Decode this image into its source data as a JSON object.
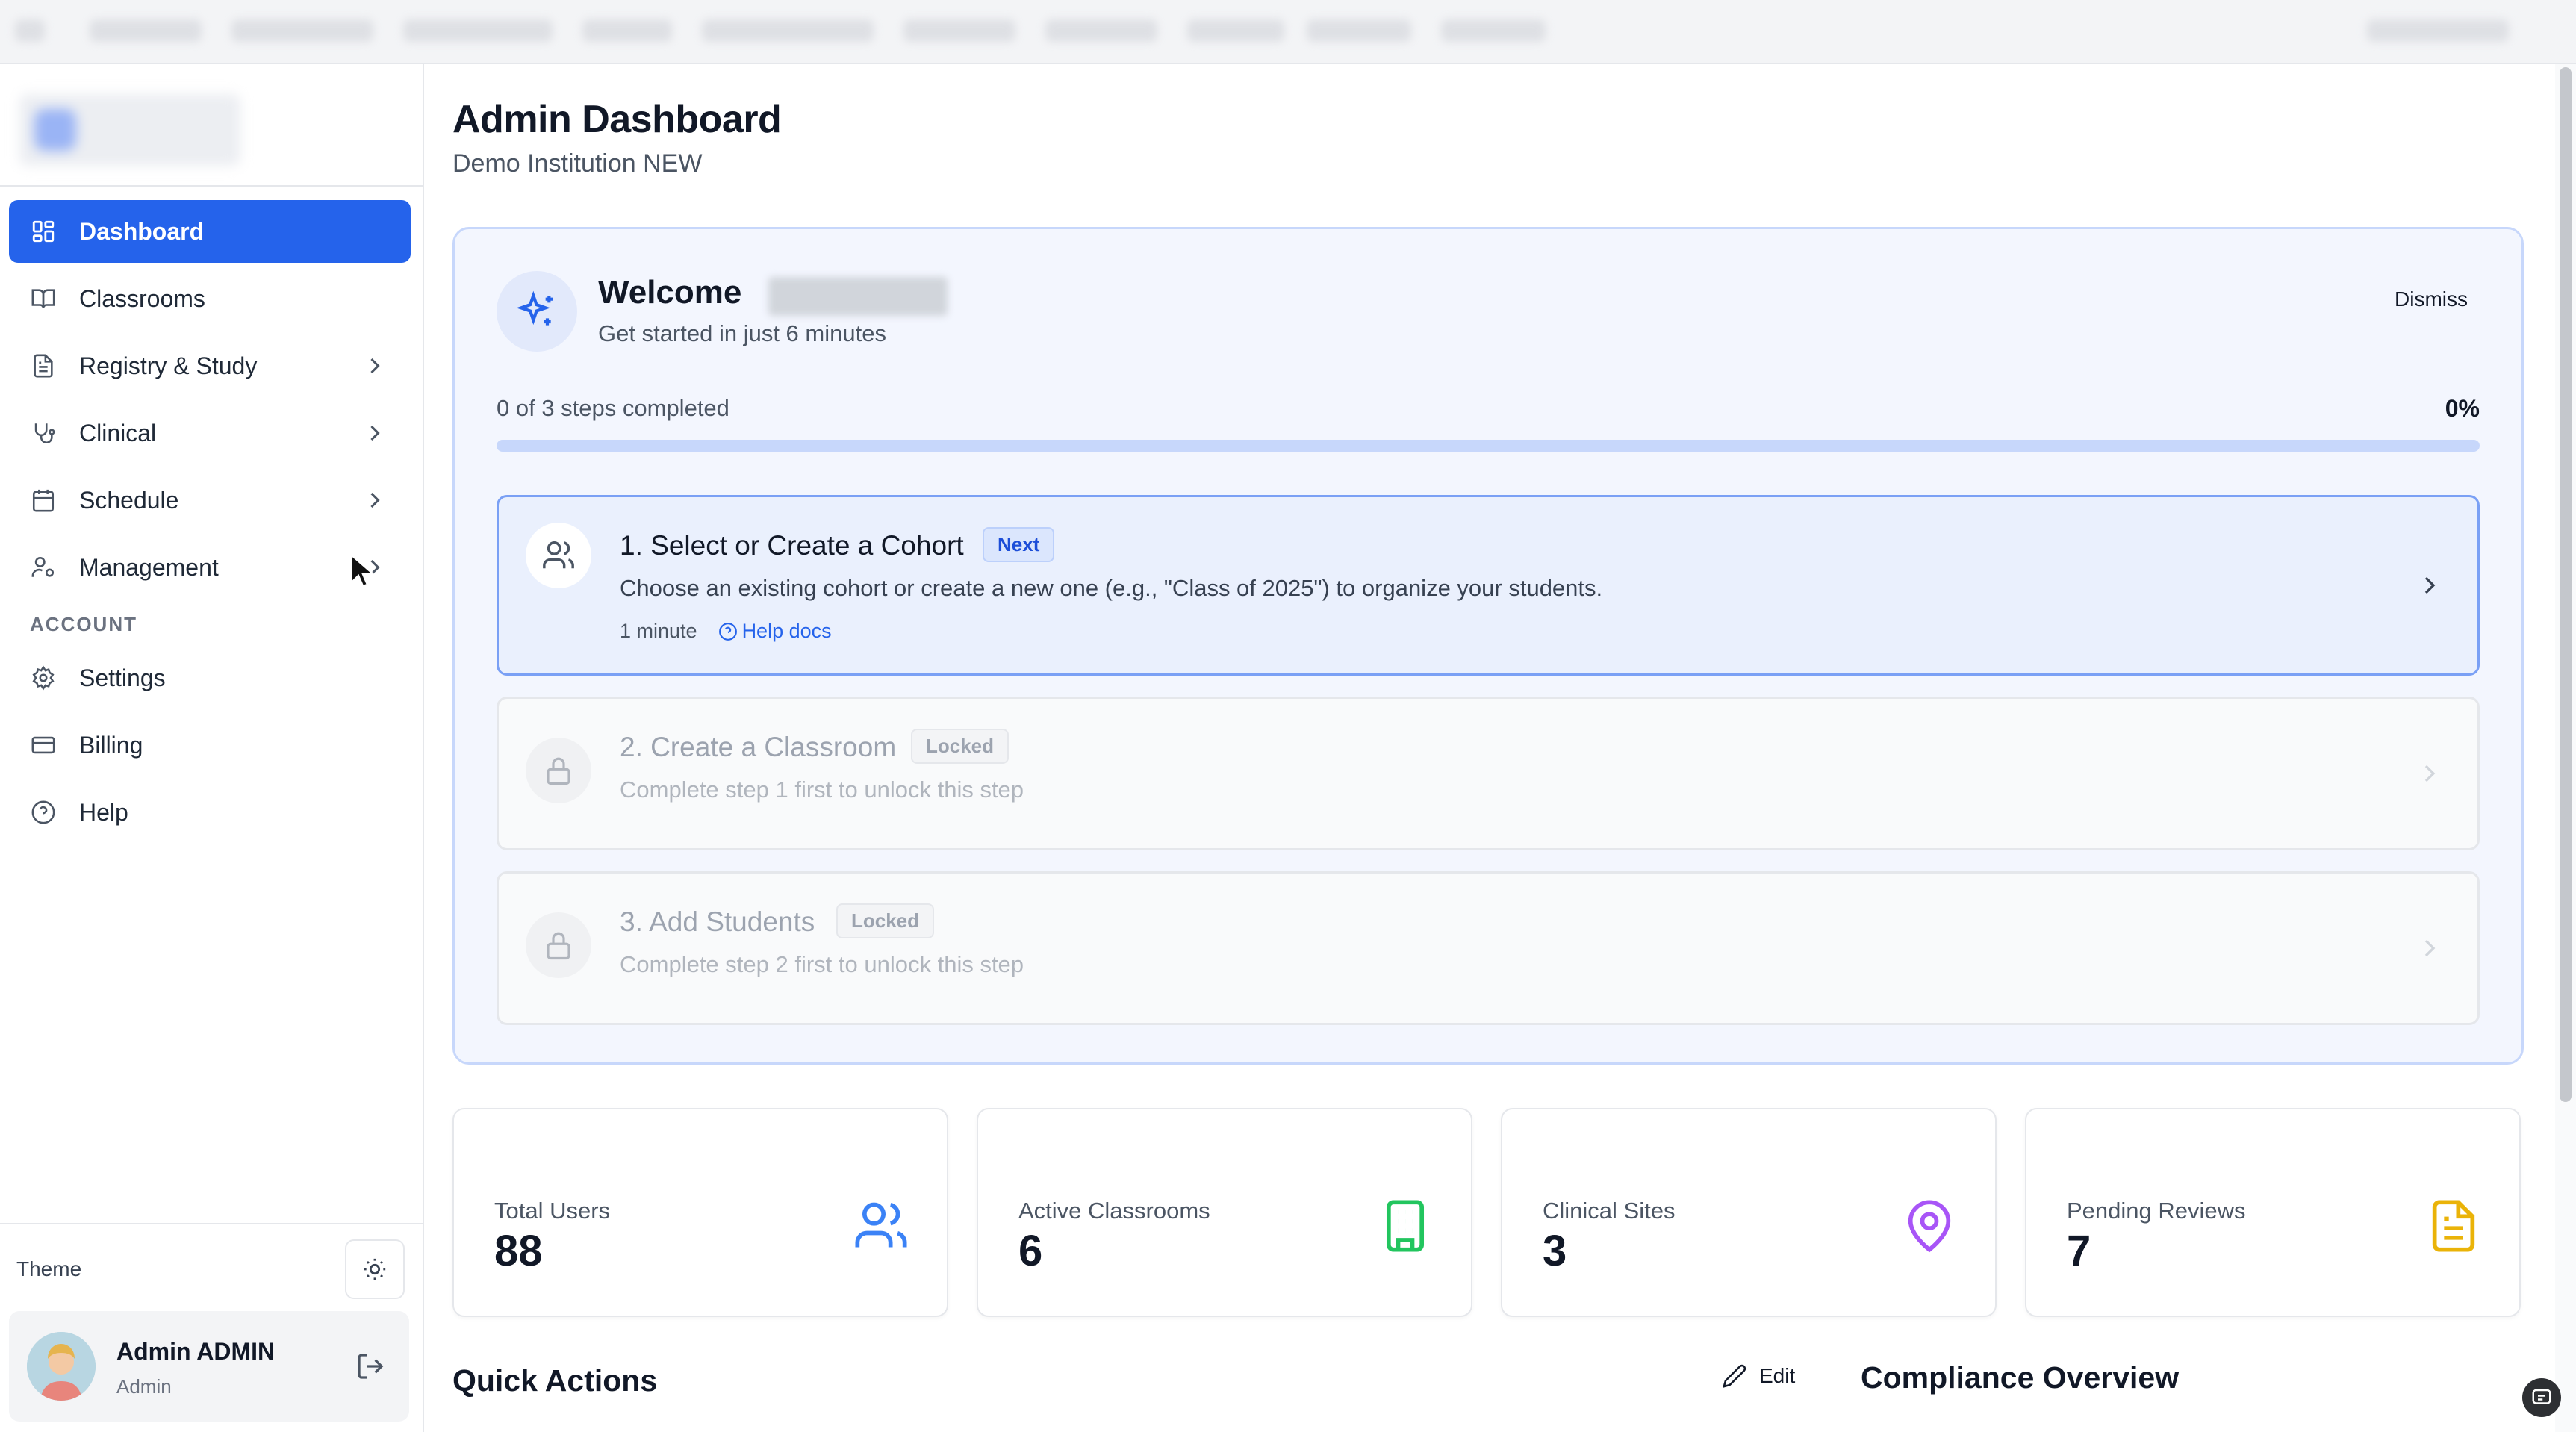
{
  "sidebar": {
    "items": [
      {
        "label": "Dashboard",
        "icon": "dashboard-grid-icon",
        "active": true
      },
      {
        "label": "Classrooms",
        "icon": "book-open-icon"
      },
      {
        "label": "Registry & Study",
        "icon": "document-icon",
        "expandable": true
      },
      {
        "label": "Clinical",
        "icon": "stethoscope-icon",
        "expandable": true
      },
      {
        "label": "Schedule",
        "icon": "calendar-icon",
        "expandable": true
      },
      {
        "label": "Management",
        "icon": "user-cog-icon",
        "expandable": true
      }
    ],
    "account_label": "ACCOUNT",
    "account_items": [
      {
        "label": "Settings",
        "icon": "gear-icon"
      },
      {
        "label": "Billing",
        "icon": "credit-card-icon"
      },
      {
        "label": "Help",
        "icon": "help-circle-icon"
      }
    ],
    "theme_label": "Theme",
    "user": {
      "name": "Admin ADMIN",
      "role": "Admin"
    }
  },
  "header": {
    "title": "Admin Dashboard",
    "subtitle": "Demo Institution NEW"
  },
  "welcome": {
    "title": "Welcome",
    "subtitle": "Get started in just 6 minutes",
    "dismiss_label": "Dismiss",
    "progress_text": "0 of 3 steps completed",
    "progress_percent_label": "0%",
    "progress_fraction": 0,
    "steps": [
      {
        "title": "1. Select or Create a Cohort",
        "badge": "Next",
        "description": "Choose an existing cohort or create a new one (e.g., \"Class of 2025\") to organize your students.",
        "duration": "1 minute",
        "help_label": "Help docs",
        "state": "active"
      },
      {
        "title": "2. Create a Classroom",
        "badge": "Locked",
        "description": "Complete step 1 first to unlock this step",
        "state": "locked"
      },
      {
        "title": "3. Add Students",
        "badge": "Locked",
        "description": "Complete step 2 first to unlock this step",
        "state": "locked"
      }
    ]
  },
  "stats": [
    {
      "label": "Total Users",
      "value": "88",
      "icon": "users-icon",
      "color": "#3b82f6"
    },
    {
      "label": "Active Classrooms",
      "value": "6",
      "icon": "building-icon",
      "color": "#22c55e"
    },
    {
      "label": "Clinical Sites",
      "value": "3",
      "icon": "map-pin-icon",
      "color": "#a855f7"
    },
    {
      "label": "Pending Reviews",
      "value": "7",
      "icon": "file-text-icon",
      "color": "#eab308"
    }
  ],
  "quick_actions": {
    "title": "Quick Actions",
    "edit_label": "Edit"
  },
  "compliance": {
    "title": "Compliance Overview"
  },
  "colors": {
    "accent": "#2563eb",
    "sidebar_active": "#2563eb"
  }
}
